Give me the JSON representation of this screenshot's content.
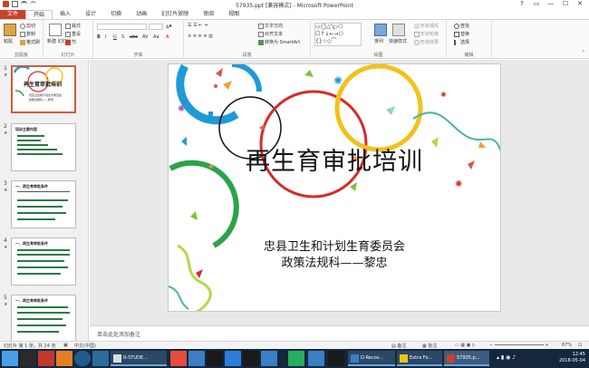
{
  "window": {
    "title": "57935.ppt [兼容模式] - Microsoft PowerPoint",
    "controls": [
      "?",
      "▭",
      "—",
      "☐",
      "✕"
    ]
  },
  "tabs": [
    "文件",
    "开始",
    "插入",
    "设计",
    "切换",
    "动画",
    "幻灯片放映",
    "审阅",
    "视图"
  ],
  "ribbon": {
    "clipboard": {
      "paste": "粘贴",
      "cut": "剪切",
      "copy": "复制",
      "format_painter": "格式刷",
      "label": "剪贴板"
    },
    "slides": {
      "new_slide": "新建\n幻灯片",
      "layout": "版式",
      "reset": "重设",
      "section": "节",
      "label": "幻灯片"
    },
    "font": {
      "bold": "B",
      "italic": "I",
      "underline": "U",
      "shadow": "S",
      "strike": "abc",
      "spacing": "AV",
      "case": "Aa",
      "color": "A",
      "label": "字体"
    },
    "paragraph": {
      "text_direction": "文字方向",
      "align_text": "对齐文本",
      "smartart": "转换为 SmartArt",
      "label": "段落"
    },
    "drawing": {
      "arrange": "排列",
      "quick_styles": "快速样式",
      "fill": "形状填充",
      "outline": "形状轮廓",
      "effects": "形状效果",
      "label": "绘图"
    },
    "editing": {
      "find": "查找",
      "replace": "替换",
      "select": "选择",
      "label": "编辑"
    }
  },
  "thumbnails": [
    {
      "num": "1",
      "title": "再生育审批培训",
      "lines": [
        "忠县卫生和计划生育委员会",
        "政策法规科——黎忠"
      ]
    },
    {
      "num": "2",
      "title": "培训主要内容"
    },
    {
      "num": "3",
      "title": "一、再生育审批条件"
    },
    {
      "num": "4",
      "title": "一、再生育审批条件"
    },
    {
      "num": "5",
      "title": "一、再生育审批条件"
    }
  ],
  "slide": {
    "title": "再生育审批培训",
    "subtitle_1": "忠县卫生和计划生育委员会",
    "subtitle_2": "政策法规科——黎忠"
  },
  "notes_placeholder": "单击此处添加备注",
  "status": {
    "slide_info": "幻灯片 第 1 张，共 24 张",
    "language": "中文(中国)",
    "notes": "备注",
    "comments": "批注",
    "zoom": "67%"
  },
  "taskbar": {
    "apps": [
      "R-STUDE...",
      "D-Recov...",
      "Extra Fo...",
      "57935.p..."
    ],
    "time": "12:45",
    "date": "2018-05-04"
  },
  "colors": {
    "file_tab": "#c8422a",
    "selection": "#d15b3c",
    "taskbar": "#14273d"
  }
}
